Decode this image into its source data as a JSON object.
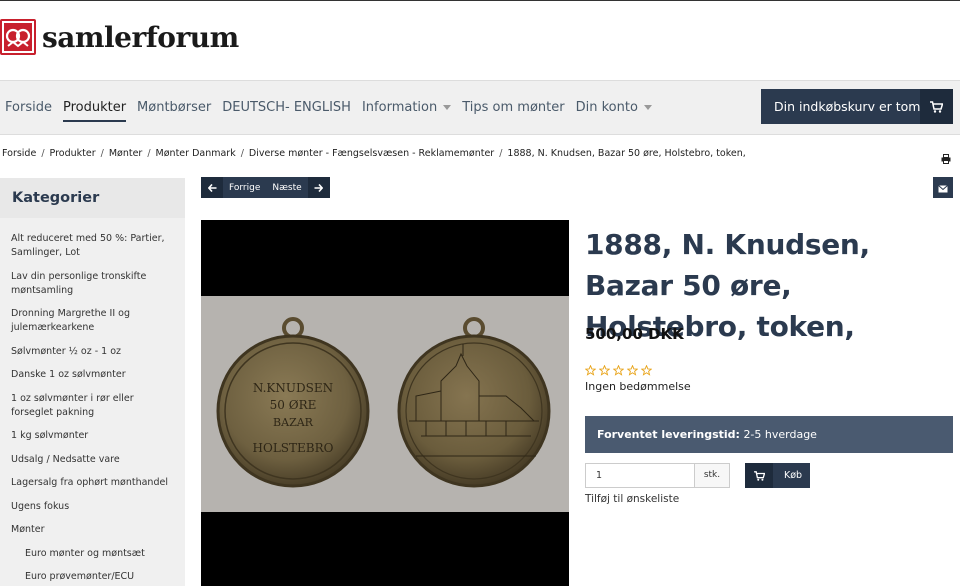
{
  "header": {
    "logo_text": "samlerforum",
    "brand_color": "#c8202d"
  },
  "nav": {
    "items": [
      {
        "label": "Forside",
        "active": false
      },
      {
        "label": "Produkter",
        "active": true
      },
      {
        "label": "Møntbørser",
        "active": false
      },
      {
        "label": "DEUTSCH- ENGLISH",
        "active": false
      },
      {
        "label": "Information",
        "active": false,
        "dropdown": true
      },
      {
        "label": "Tips om mønter",
        "active": false
      },
      {
        "label": "Din konto",
        "active": false,
        "dropdown": true
      }
    ],
    "cart_label": "Din indkøbskurv er tom",
    "cart_icon": "cart-icon"
  },
  "breadcrumb": [
    "Forside",
    "Produkter",
    "Mønter",
    "Mønter Danmark",
    "Diverse mønter - Fængselsvæsen - Reklamemønter",
    "1888, N. Knudsen, Bazar 50 øre, Holstebro, token,"
  ],
  "sidebar": {
    "title": "Kategorier",
    "items": [
      {
        "label": "Alt reduceret med 50 %: Partier, Samlinger, Lot",
        "sub": false
      },
      {
        "label": "Lav din personlige tronskifte møntsamling",
        "sub": false
      },
      {
        "label": "Dronning Margrethe II og julemærkearkene",
        "sub": false
      },
      {
        "label": "Sølvmønter ½ oz - 1 oz",
        "sub": false
      },
      {
        "label": "Danske 1 oz sølvmønter",
        "sub": false
      },
      {
        "label": "1 oz sølvmønter i rør eller forseglet pakning",
        "sub": false
      },
      {
        "label": "1 kg sølvmønter",
        "sub": false
      },
      {
        "label": "Udsalg / Nedsatte vare",
        "sub": false
      },
      {
        "label": "Lagersalg fra ophørt mønthandel",
        "sub": false
      },
      {
        "label": "Ugens fokus",
        "sub": false
      },
      {
        "label": "Mønter",
        "sub": false
      },
      {
        "label": "Euro mønter og møntsæt",
        "sub": true
      },
      {
        "label": "Euro prøvemønter/ECU",
        "sub": true
      }
    ]
  },
  "pager": {
    "prev_label": "Forrige",
    "next_label": "Næste"
  },
  "product": {
    "title": "1888, N. Knudsen, Bazar 50 øre, Holstebro, token,",
    "price": "500,00 DKK",
    "rating_text": "Ingen bedømmelse",
    "rating_stars": 0,
    "rating_max": 5,
    "star_color": "#e8a317",
    "delivery_label": "Forventet leveringstid:",
    "delivery_value": "2-5 hverdage",
    "quantity": "1",
    "quantity_unit": "stk.",
    "buy_label": "Køb",
    "wishlist_label": "Tilføj til ønskeliste",
    "coin_text": [
      "N.KNUDSEN",
      "50 ØRE",
      "BAZAR",
      "HOLSTEBRO"
    ]
  }
}
